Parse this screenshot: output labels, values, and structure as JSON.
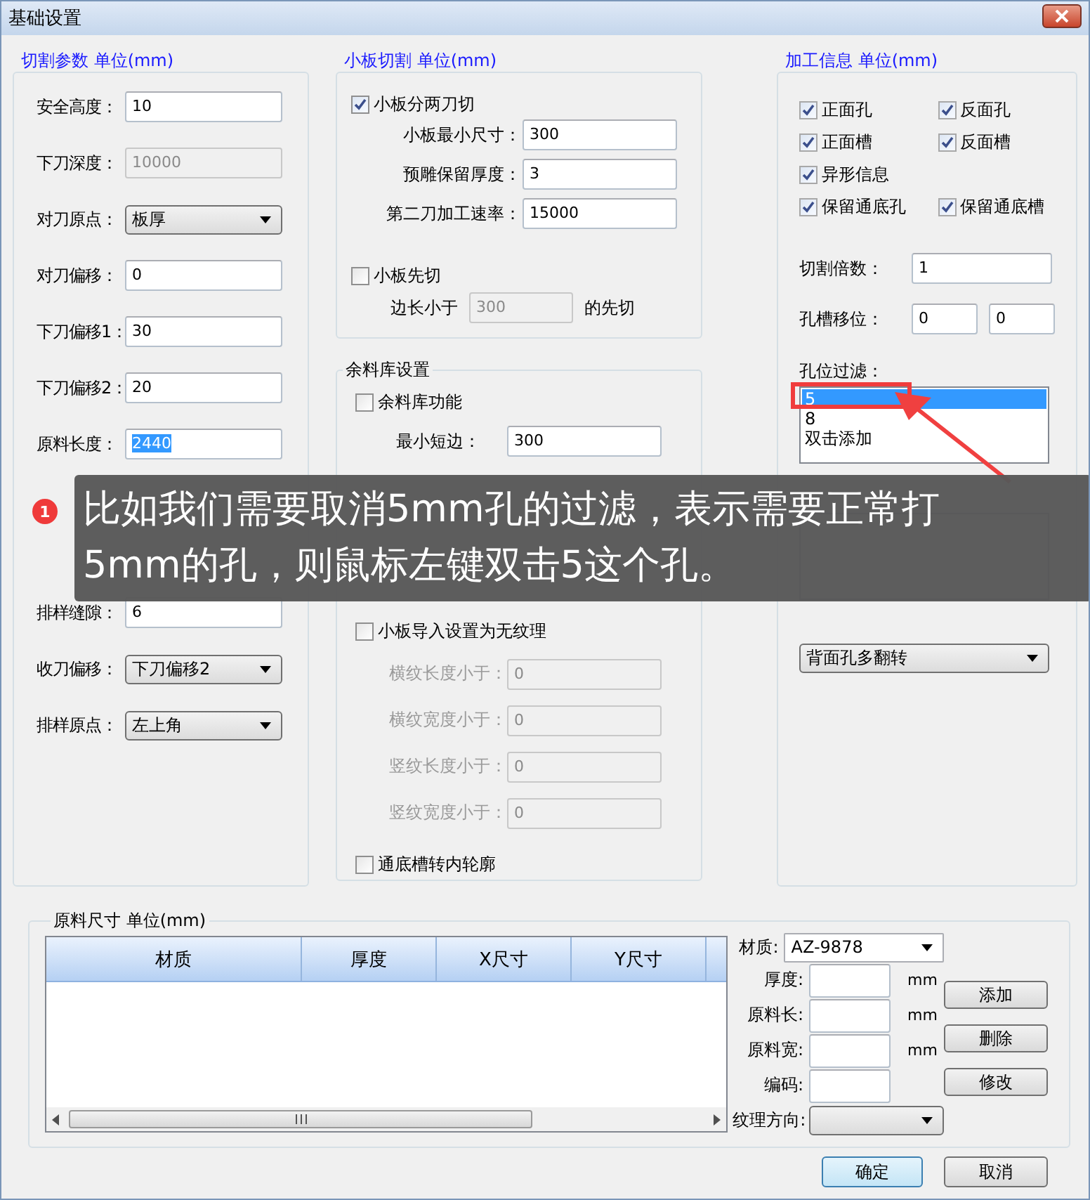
{
  "window": {
    "title": "基础设置"
  },
  "cutting": {
    "title": "切割参数 单位(mm)",
    "rows": [
      {
        "kind": "input",
        "label": "安全高度：",
        "value": "10",
        "disabled": false,
        "highlighted": false
      },
      {
        "kind": "input",
        "label": "下刀深度：",
        "value": "10000",
        "disabled": true,
        "highlighted": false
      },
      {
        "kind": "select",
        "label": "对刀原点：",
        "value": "板厚"
      },
      {
        "kind": "input",
        "label": "对刀偏移：",
        "value": "0",
        "disabled": false,
        "highlighted": false
      },
      {
        "kind": "input",
        "label": "下刀偏移1：",
        "value": "30",
        "disabled": false,
        "highlighted": false
      },
      {
        "kind": "input",
        "label": "下刀偏移2：",
        "value": "20",
        "disabled": false,
        "highlighted": false
      },
      {
        "kind": "input",
        "label": "原料长度：",
        "value": "2440",
        "disabled": false,
        "highlighted": true
      },
      {
        "kind": "input",
        "label": "排样缝隙：",
        "value": "6",
        "disabled": false,
        "highlighted": false
      },
      {
        "kind": "select",
        "label": "收刀偏移：",
        "value": "下刀偏移2"
      },
      {
        "kind": "select",
        "label": "排样原点：",
        "value": "左上角"
      }
    ]
  },
  "small_board": {
    "title": "小板切割 单位(mm)",
    "two_cut": {
      "label": "小板分两刀切",
      "checked": true
    },
    "rows": [
      {
        "label": "小板最小尺寸：",
        "value": "300"
      },
      {
        "label": "预雕保留厚度：",
        "value": "3"
      },
      {
        "label": "第二刀加工速率：",
        "value": "15000"
      }
    ],
    "first_cut": {
      "label": "小板先切",
      "checked": false
    },
    "edge": {
      "label": "边长小于",
      "value": "300",
      "disabled": true,
      "suffix": "的先切"
    }
  },
  "remnant": {
    "title": "余料库设置",
    "enable": {
      "label": "余料库功能",
      "checked": false
    },
    "min_short": {
      "label": "最小短边：",
      "value": "300"
    },
    "no_grain": {
      "label": "小板导入设置为无纹理",
      "checked": false
    },
    "grain_rows": [
      {
        "label": "横纹长度小于：",
        "value": "0",
        "disabled": true
      },
      {
        "label": "横纹宽度小于：",
        "value": "0",
        "disabled": true
      },
      {
        "label": "竖纹长度小于：",
        "value": "0",
        "disabled": true
      },
      {
        "label": "竖纹宽度小于：",
        "value": "0",
        "disabled": true
      }
    ],
    "groove": {
      "label": "通底槽转内轮廓",
      "checked": false
    }
  },
  "processing": {
    "title": "加工信息 单位(mm)",
    "check_rows": [
      {
        "items": [
          {
            "label": "正面孔",
            "checked": true
          },
          {
            "label": "反面孔",
            "checked": true
          }
        ]
      },
      {
        "items": [
          {
            "label": "正面槽",
            "checked": true
          },
          {
            "label": "反面槽",
            "checked": true
          }
        ]
      },
      {
        "items": [
          {
            "label": "异形信息",
            "checked": true
          }
        ]
      },
      {
        "items": [
          {
            "label": "保留通底孔",
            "checked": true
          },
          {
            "label": "保留通底槽",
            "checked": true
          }
        ]
      }
    ],
    "multiple": {
      "label": "切割倍数：",
      "value": "1"
    },
    "shift": {
      "label": "孔槽移位：",
      "values": [
        "0",
        "0"
      ]
    },
    "filter": {
      "label": "孔位过滤：",
      "items": [
        {
          "text": "5",
          "selected": true
        },
        {
          "text": "8",
          "selected": false
        },
        {
          "text": "双击添加",
          "selected": false
        }
      ]
    },
    "flip": {
      "value": "背面孔多翻转"
    }
  },
  "materials": {
    "title": "原料尺寸 单位(mm)",
    "columns": [
      "材质",
      "厚度",
      "X尺寸",
      "Y尺寸"
    ],
    "form": [
      {
        "kind": "select",
        "label": "材质:",
        "value": "AZ-9878"
      },
      {
        "kind": "input",
        "label": "厚度:",
        "unit": "mm"
      },
      {
        "kind": "input",
        "label": "原料长:",
        "unit": "mm"
      },
      {
        "kind": "input",
        "label": "原料宽:",
        "unit": "mm"
      },
      {
        "kind": "input",
        "label": "编码:"
      },
      {
        "kind": "select",
        "label": "纹理方向:"
      }
    ],
    "buttons": [
      "添加",
      "删除",
      "修改"
    ]
  },
  "footer": {
    "buttons": [
      {
        "label": "确定",
        "default": true
      },
      {
        "label": "取消",
        "default": false
      }
    ]
  },
  "callout": {
    "badge": "1",
    "text": "比如我们需要取消5mm孔的过滤，表示需要正常打5mm的孔，则鼠标左键双击5这个孔。"
  }
}
